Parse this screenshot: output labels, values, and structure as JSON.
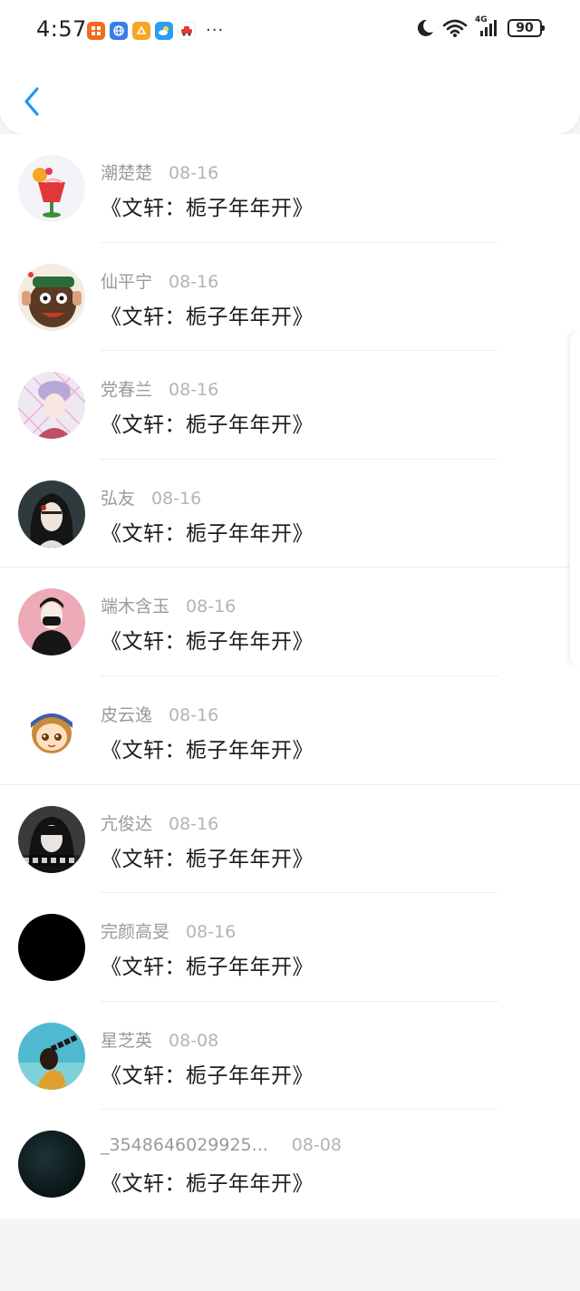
{
  "status_bar": {
    "time": "4:57",
    "battery": "90",
    "network": "4G",
    "notification_icons": [
      {
        "name": "app-icon-orange",
        "color": "#f26b1d"
      },
      {
        "name": "app-icon-blue-globe",
        "color": "#3b7be8"
      },
      {
        "name": "app-icon-yellow",
        "color": "#f5a623"
      },
      {
        "name": "app-icon-weather",
        "color": "#2a9df4"
      },
      {
        "name": "app-icon-red-car",
        "color": "#e53935"
      }
    ],
    "more_indicator": "···"
  },
  "header": {
    "back_icon": "chevron-left-icon",
    "accent_color": "#2196f3"
  },
  "comments": [
    {
      "user": "潮楚楚",
      "date": "08-16",
      "title": "《文轩：栀子年年开》"
    },
    {
      "user": "仙平宁",
      "date": "08-16",
      "title": "《文轩：栀子年年开》"
    },
    {
      "user": "党春兰",
      "date": "08-16",
      "title": "《文轩：栀子年年开》"
    },
    {
      "user": "弘友",
      "date": "08-16",
      "title": "《文轩：栀子年年开》"
    },
    {
      "user": "端木含玉",
      "date": "08-16",
      "title": "《文轩：栀子年年开》"
    },
    {
      "user": "皮云逸",
      "date": "08-16",
      "title": "《文轩：栀子年年开》"
    },
    {
      "user": "亢俊达",
      "date": "08-16",
      "title": "《文轩：栀子年年开》"
    },
    {
      "user": "完颜高旻",
      "date": "08-16",
      "title": "《文轩：栀子年年开》"
    },
    {
      "user": "星芝英",
      "date": "08-08",
      "title": "《文轩：栀子年年开》"
    },
    {
      "user": "_3548646029925...",
      "date": "08-08",
      "title": "《文轩：栀子年年开》"
    }
  ]
}
